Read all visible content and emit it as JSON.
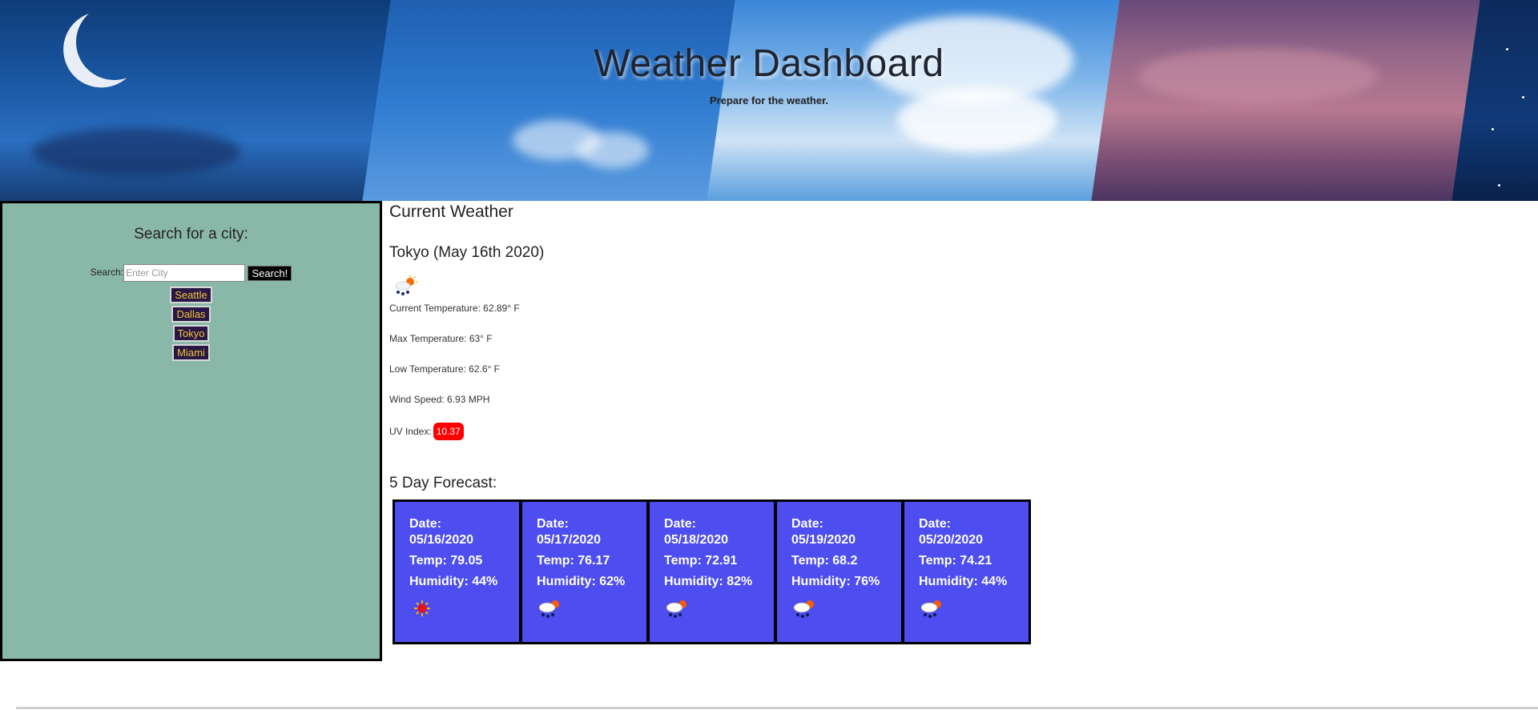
{
  "header": {
    "title": "Weather Dashboard",
    "subtitle": "Prepare for the weather."
  },
  "sidebar": {
    "heading": "Search for a city:",
    "search_label": "Search:",
    "search_placeholder": "Enter City",
    "search_button": "Search!",
    "cities": [
      "Seattle",
      "Dallas",
      "Tokyo",
      "Miami"
    ]
  },
  "current": {
    "heading": "Current Weather",
    "city_date": "Tokyo (May 16th 2020)",
    "icon": "rain-sun-icon",
    "temperature": "Current Temperature: 62.89° F",
    "max_temp": "Max Temperature: 63° F",
    "low_temp": "Low Temperature: 62.6° F",
    "wind": "Wind Speed: 6.93 MPH",
    "uv_label": "UV Index:",
    "uv_value": "10.37",
    "uv_color": "#ff0000"
  },
  "forecast": {
    "heading": "5 Day Forecast:",
    "days": [
      {
        "date_label": "Date:",
        "date": "05/16/2020",
        "temp": "Temp: 79.05",
        "humidity": "Humidity: 44%",
        "icon": "sun-icon"
      },
      {
        "date_label": "Date:",
        "date": "05/17/2020",
        "temp": "Temp: 76.17",
        "humidity": "Humidity: 62%",
        "icon": "rain-sun-icon"
      },
      {
        "date_label": "Date:",
        "date": "05/18/2020",
        "temp": "Temp: 72.91",
        "humidity": "Humidity: 82%",
        "icon": "rain-sun-icon"
      },
      {
        "date_label": "Date:",
        "date": "05/19/2020",
        "temp": "Temp: 68.2",
        "humidity": "Humidity: 76%",
        "icon": "rain-sun-icon"
      },
      {
        "date_label": "Date:",
        "date": "05/20/2020",
        "temp": "Temp: 74.21",
        "humidity": "Humidity: 44%",
        "icon": "rain-sun-icon"
      }
    ],
    "card_color": "#4d4df0"
  },
  "colors": {
    "sidebar_bg": "#8ab8a8",
    "city_button_bg": "#2a1844",
    "city_button_text": "#f2c23a"
  }
}
